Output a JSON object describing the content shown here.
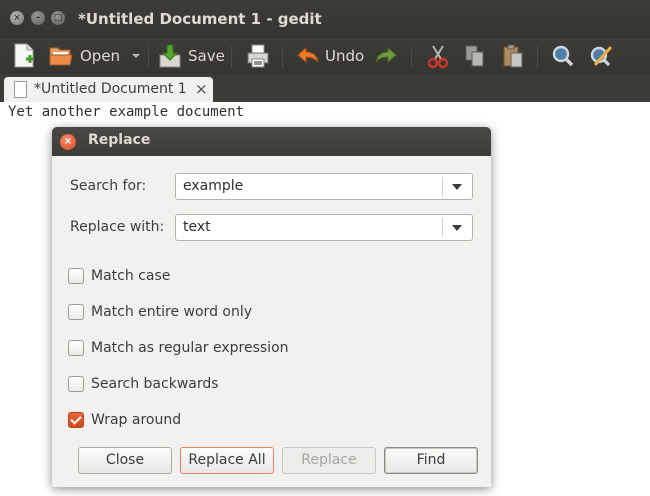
{
  "window": {
    "title": "*Untitled Document 1 - gedit"
  },
  "toolbar": {
    "open_label": "Open",
    "save_label": "Save",
    "undo_label": "Undo"
  },
  "tab": {
    "label": "*Untitled Document 1",
    "close": "×"
  },
  "editor": {
    "text": "Yet another example document"
  },
  "dialog": {
    "title": "Replace",
    "search_label": "Search for:",
    "search_value": "example",
    "replace_label": "Replace with:",
    "replace_value": "text",
    "options": [
      {
        "label": "Match case",
        "checked": false
      },
      {
        "label": "Match entire word only",
        "checked": false
      },
      {
        "label": "Match as regular expression",
        "checked": false
      },
      {
        "label": "Search backwards",
        "checked": false
      },
      {
        "label": "Wrap around",
        "checked": true
      }
    ],
    "buttons": {
      "close": "Close",
      "replace_all": "Replace All",
      "replace": "Replace",
      "find": "Find"
    }
  },
  "colors": {
    "accent": "#dd4814",
    "titlebar": "#3c3b37",
    "dialog_bg": "#f2f1f0"
  }
}
